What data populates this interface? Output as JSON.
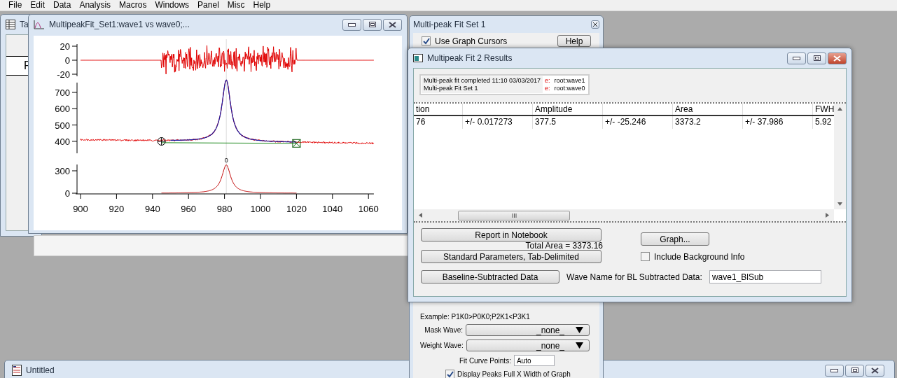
{
  "menu_bar": [
    "File",
    "Edit",
    "Data",
    "Analysis",
    "Macros",
    "Windows",
    "Panel",
    "Misc",
    "Help"
  ],
  "table_window": {
    "title": "Ta",
    "column_header": "F"
  },
  "graph_window": {
    "title": "MultipeakFit_Set1:wave1 vs wave0;...",
    "panels": [
      {
        "kind": "residual",
        "yticks": [
          "20",
          "0",
          "-20"
        ]
      },
      {
        "kind": "data",
        "yticks": [
          "700",
          "600",
          "500",
          "400"
        ]
      },
      {
        "kind": "peak",
        "yticks": [
          "300",
          "0"
        ],
        "peak_label": "0"
      }
    ],
    "xticks": [
      "900",
      "920",
      "940",
      "960",
      "980",
      "1000",
      "1020",
      "1040",
      "1060"
    ]
  },
  "fit_panel": {
    "title": "Multi-peak Fit Set 1",
    "use_graph_cursors": {
      "label": "Use Graph Cursors",
      "checked": true
    },
    "help_button": "Help",
    "example": "Example: P1K0>P0K0;P2K1<P3K1",
    "mask_wave": {
      "label": "Mask Wave:",
      "value": "_none_"
    },
    "weight_wave": {
      "label": "Weight Wave:",
      "value": "_none_"
    },
    "fit_curve_points": {
      "label": "Fit Curve Points:",
      "value": "Auto"
    },
    "display_peaks": {
      "label": "Display Peaks Full X Width of Graph",
      "checked": true
    }
  },
  "results_window": {
    "title": "Multipeak Fit 2 Results",
    "info": [
      {
        "text": "Multi-peak fit completed 11:10 03/03/2017",
        "marker": "e:",
        "wave": "root:wave1"
      },
      {
        "text": "Multi-peak Fit Set 1",
        "marker": "e:",
        "wave": "root:wave0"
      }
    ],
    "columns": [
      {
        "kind": "value",
        "label": "tion"
      },
      {
        "kind": "error"
      },
      {
        "kind": "value",
        "label": "Amplitude"
      },
      {
        "kind": "error"
      },
      {
        "kind": "value",
        "label": "Area"
      },
      {
        "kind": "error"
      },
      {
        "kind": "value",
        "label": "FWH"
      }
    ],
    "rows": [
      [
        "76",
        "+/- 0.017273",
        "377.5",
        "+/- -25.246",
        "3373.2",
        "+/- 37.986",
        "5.92"
      ]
    ],
    "report_button": "Report in Notebook",
    "graph_button": "Graph...",
    "total_area": "Total Area = 3373.16",
    "standard_button": "Standard Parameters, Tab-Delimited",
    "include_background": {
      "label": "Include Background Info",
      "checked": false
    },
    "baseline_button": "Baseline-Subtracted Data",
    "wave_name": {
      "label": "Wave Name for BL Subtracted Data:",
      "value": "wave1_BlSub"
    }
  },
  "untitled_window": {
    "title": "Untitled"
  }
}
